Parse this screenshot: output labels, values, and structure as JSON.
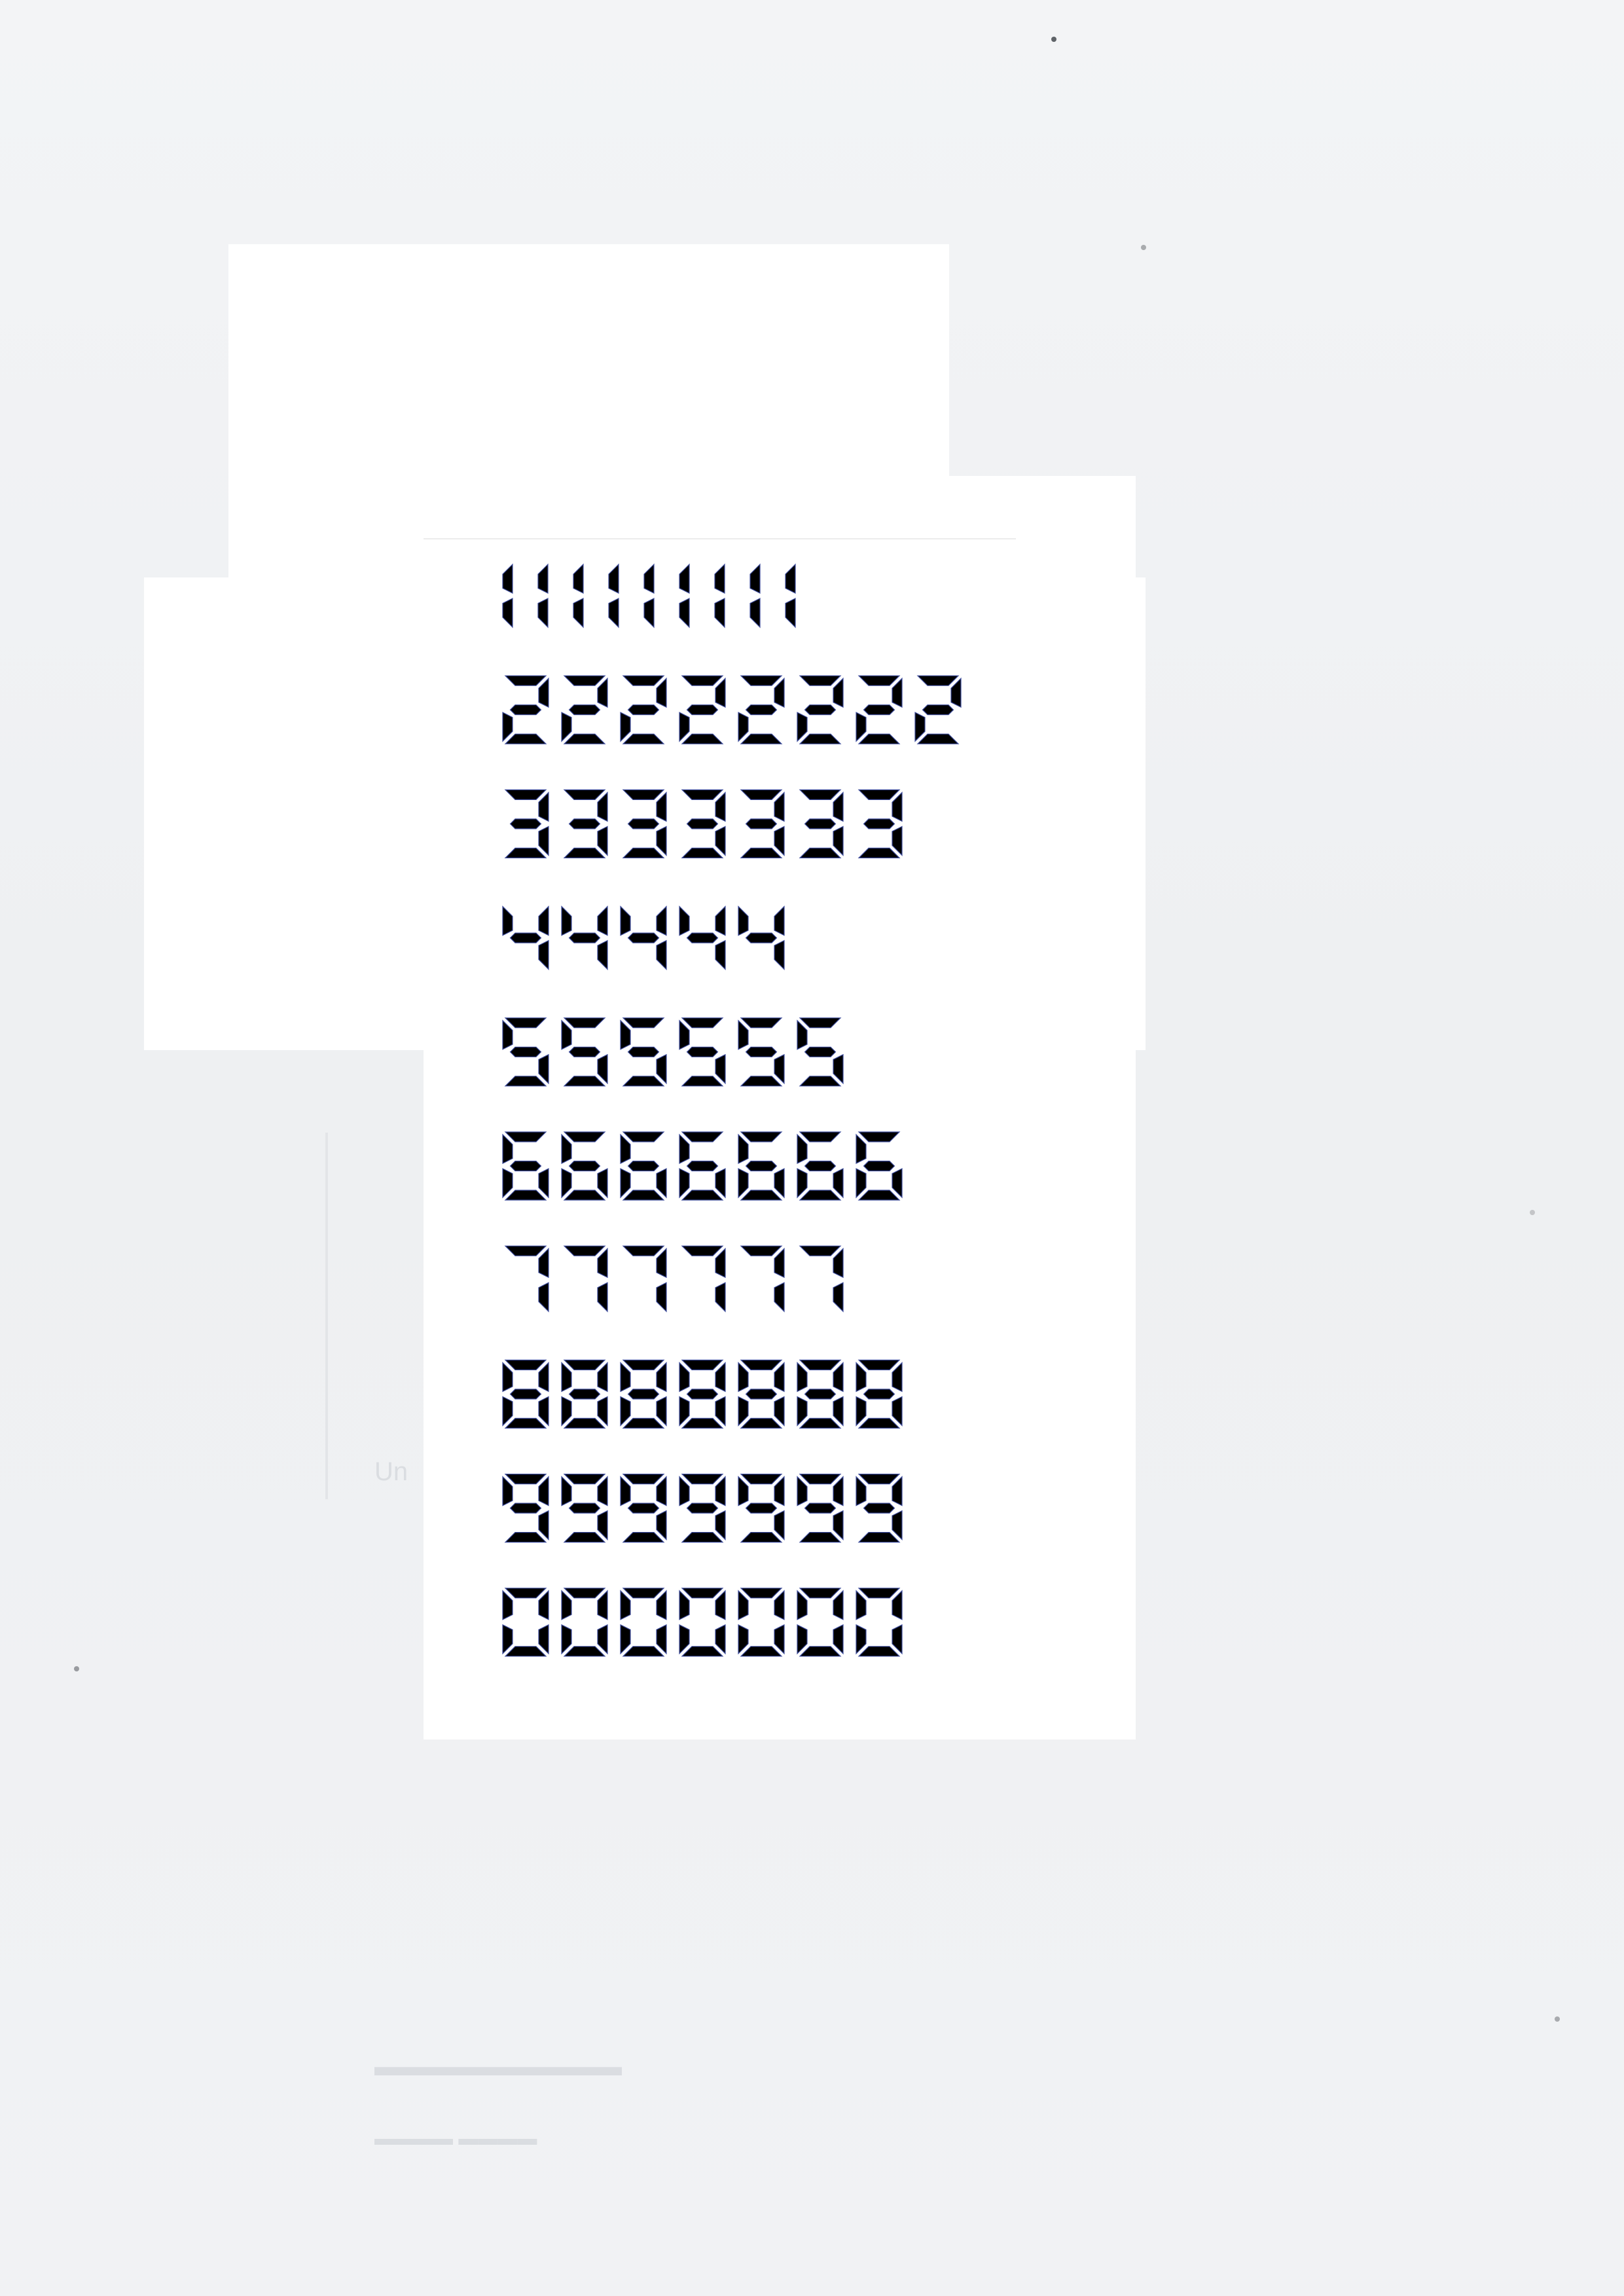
{
  "digit_rows": [
    {
      "digit": "1",
      "count": 9,
      "text": "111111111"
    },
    {
      "digit": "2",
      "count": 8,
      "text": "22222222"
    },
    {
      "digit": "3",
      "count": 7,
      "text": "3333333"
    },
    {
      "digit": "4",
      "count": 5,
      "text": "44444"
    },
    {
      "digit": "5",
      "count": 6,
      "text": "555555"
    },
    {
      "digit": "6",
      "count": 7,
      "text": "6666666"
    },
    {
      "digit": "7",
      "count": 6,
      "text": "777777"
    },
    {
      "digit": "8",
      "count": 7,
      "text": "8888888"
    },
    {
      "digit": "9",
      "count": 7,
      "text": "9999999"
    },
    {
      "digit": "0",
      "count": 7,
      "text": "0000000"
    }
  ],
  "colors": {
    "ink": "#000000",
    "paper": "#f1f2f4",
    "patch": "#ffffff"
  }
}
